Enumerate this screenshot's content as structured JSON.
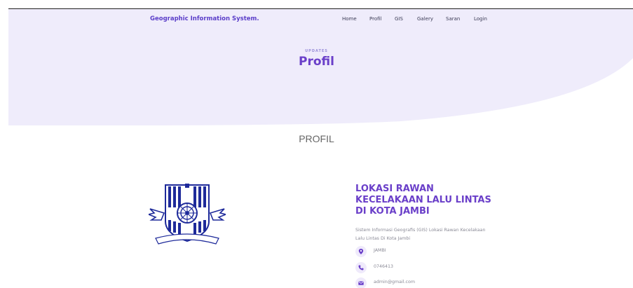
{
  "brand": "Geographic Information System.",
  "nav": [
    "Home",
    "Profil",
    "GIS",
    "Galery",
    "Saran",
    "Login"
  ],
  "hero": {
    "kicker": "UPDATES",
    "title": "Profil"
  },
  "section_title": "PROFIL",
  "org": {
    "title_lines": [
      "LOKASI RAWAN",
      "KECELAKAAN LALU LINTAS",
      "DI KOTA JAMBI"
    ],
    "desc_lines": [
      "Sistem Informasi Geografis (GIS) Lokasi Rawan Kecelakaan",
      "Lalu Lintas Di Kota Jambi"
    ],
    "logo_motto": "Dharma Wira Bhayangkara"
  },
  "contacts": [
    {
      "icon": "map-pin-icon",
      "value": "JAMBI"
    },
    {
      "icon": "phone-icon",
      "value": "0746413"
    },
    {
      "icon": "email-icon",
      "value": "admin@gmail.com"
    }
  ],
  "colors": {
    "accent": "#6a3fc9",
    "hero_bg": "#efecfb",
    "icon_badge": "#efeafb"
  }
}
